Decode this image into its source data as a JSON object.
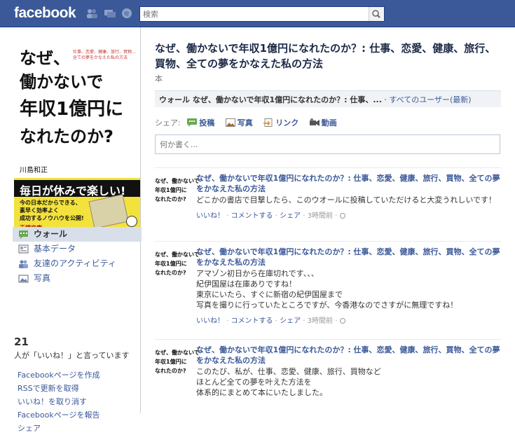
{
  "topbar": {
    "logo": "facebook",
    "search_placeholder": "検索",
    "jewels": [
      "friend-requests-icon",
      "messages-icon",
      "notifications-icon"
    ]
  },
  "cover": {
    "title_lines": [
      "なぜ、",
      "働かないで",
      "年収1億円に",
      "なれたのか?"
    ],
    "tagline": "仕事、恋愛、健康、旅行、買物…全ての夢をかなえた私の方法",
    "author": "川島和正",
    "band_head": "毎日が休みで楽しい!",
    "band_body": [
      "今の日本だからできる、",
      "素早く効率よく",
      "成功するノウハウを公開!"
    ],
    "band_foot": "王様文庫"
  },
  "leftnav": [
    {
      "label": "ウォール",
      "icon": "wall-icon",
      "active": true
    },
    {
      "label": "基本データ",
      "icon": "info-icon",
      "active": false
    },
    {
      "label": "友達のアクティビティ",
      "icon": "friends-activity-icon",
      "active": false
    },
    {
      "label": "写真",
      "icon": "photos-icon",
      "active": false
    }
  ],
  "likes": {
    "count": "21",
    "text": "人が「いいね！」と言っています"
  },
  "left_links": [
    "Facebookページを作成",
    "RSSで更新を取得",
    "いいね！を取り消す",
    "Facebookページを報告",
    "シェア"
  ],
  "page": {
    "title": "なぜ、働かないで年収1億円になれたのか？: 仕事、恋愛、健康、旅行、買物、全ての夢をかなえた私の方法",
    "category": "本"
  },
  "filterbar": {
    "selected": "ウォール なぜ、働かないで年収1億円になれたのか？: 仕事、...",
    "separator": " · ",
    "link": "すべてのユーザー(最新)"
  },
  "share": {
    "label": "シェア:",
    "buttons": [
      {
        "label": "投稿",
        "icon": "status-icon"
      },
      {
        "label": "写真",
        "icon": "photo-icon"
      },
      {
        "label": "リンク",
        "icon": "link-icon"
      },
      {
        "label": "動画",
        "icon": "video-icon"
      }
    ],
    "composer_placeholder": "何か書く..."
  },
  "stories": [
    {
      "actor": "なぜ、働かないで年収1億円になれたのか？: 仕事、恋愛、健康、旅行、買物、全ての夢をかなえた私の方法",
      "message": [
        "どこかの書店で目撃したら、このウオールに投稿していただけると大変うれしいです！"
      ],
      "meta_like": "いいね！",
      "meta_comment": "コメントする",
      "meta_share": "シェア",
      "meta_time": "3時間前"
    },
    {
      "actor": "なぜ、働かないで年収1億円になれたのか？: 仕事、恋愛、健康、旅行、買物、全ての夢をかなえた私の方法",
      "message": [
        "アマゾン初日から在庫切れです、、、",
        "紀伊国屋は在庫ありですね！",
        "東京にいたら、すぐに新宿の紀伊国屋まで",
        "写真を撮りに行っていたところですが、今香港なのでさすがに無理ですね！"
      ],
      "meta_like": "いいね！",
      "meta_comment": "コメントする",
      "meta_share": "シェア",
      "meta_time": "3時間前"
    },
    {
      "actor": "なぜ、働かないで年収1億円になれたのか？: 仕事、恋愛、健康、旅行、買物、全ての夢をかなえた私の方法",
      "message": [
        "このたび、私が、仕事、恋愛、健康、旅行、買物など",
        "ほとんど全ての夢を叶えた方法を",
        "体系的にまとめて本にいたしました。"
      ],
      "meta_like": "",
      "meta_comment": "",
      "meta_share": "",
      "meta_time": ""
    }
  ],
  "thumb_lines": [
    "なぜ、働かないで",
    "年収1億円に",
    "なれたのか?"
  ],
  "colors": {
    "brand": "#3b5998",
    "nav_active": "#d8dfea",
    "filter_bg": "#f0f2f5"
  }
}
